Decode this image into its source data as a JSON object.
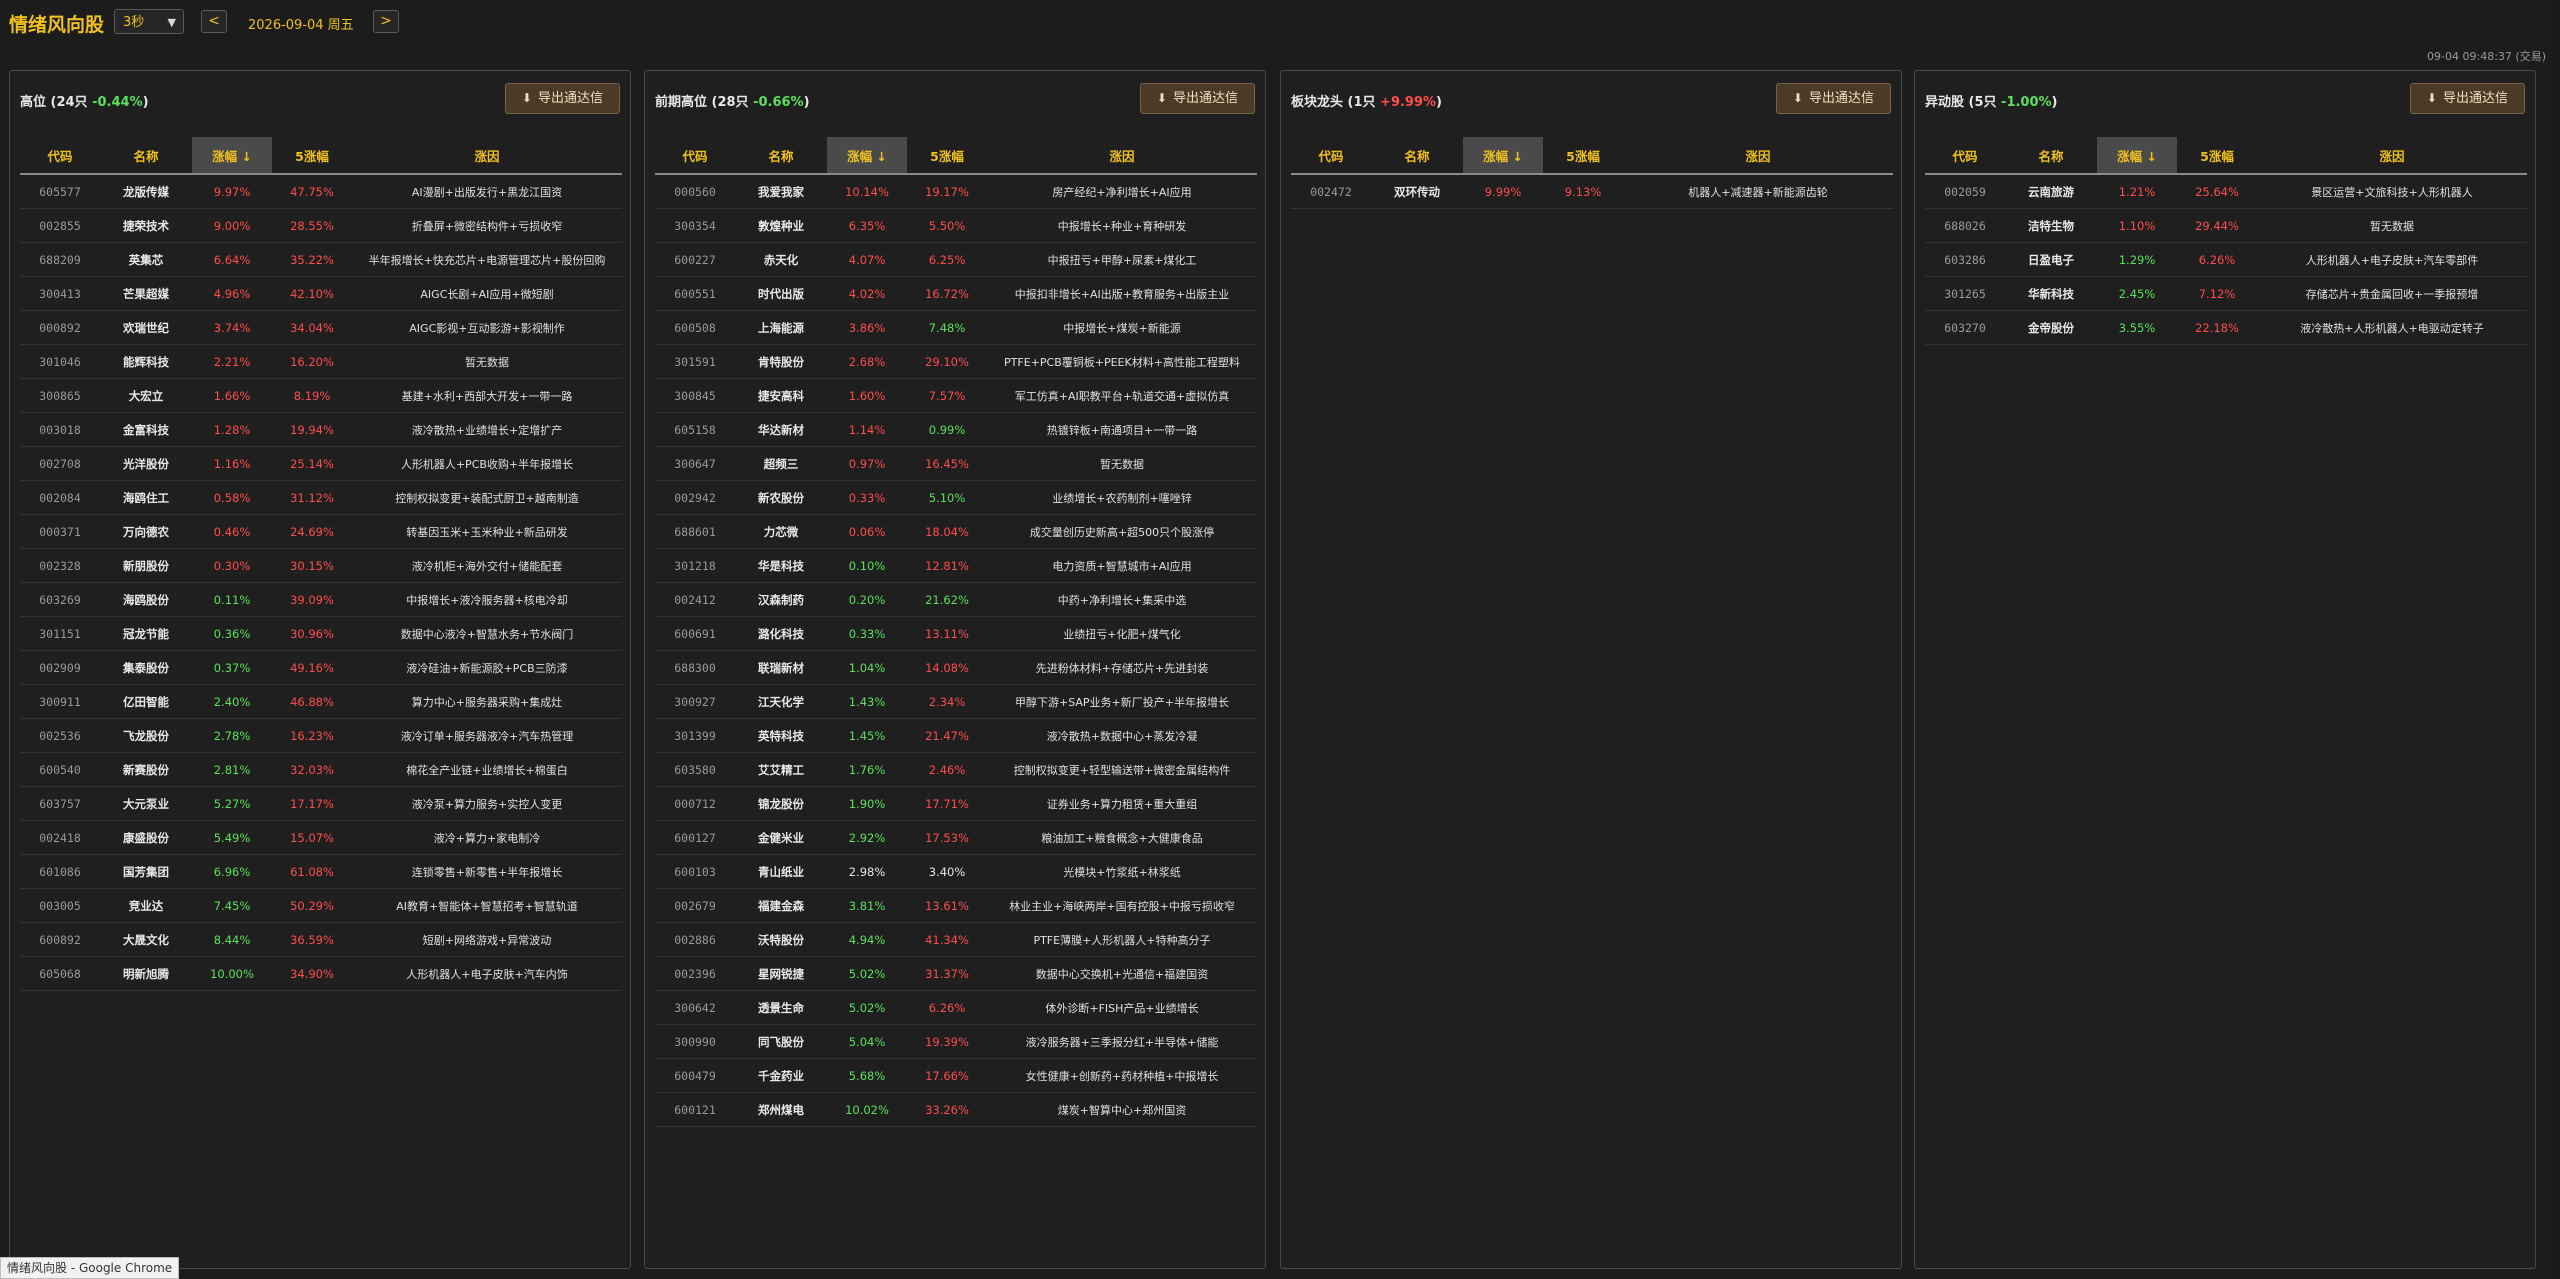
{
  "app": {
    "title": "情绪风向股",
    "interval": "3秒",
    "prev": "<",
    "next": ">",
    "date": "2026-09-04 周五",
    "timestamp": "09-04 09:48:37 (交易)",
    "status": "情绪风向股 - Google Chrome"
  },
  "columns": [
    "代码",
    "名称",
    "涨幅 ↓",
    "5涨幅",
    "涨因"
  ],
  "export_label": "导出通达信",
  "panels": [
    {
      "title": "高位 (24只 ",
      "pct": "-0.44%",
      "pct_dir": "down",
      "tail": ")",
      "rows": [
        {
          "code": "605577",
          "name": "龙版传媒",
          "chg": "9.97%",
          "chg_dir": "up",
          "chg5": "47.75%",
          "chg5_dir": "up",
          "reason": "AI漫剧+出版发行+黑龙江国资"
        },
        {
          "code": "002855",
          "name": "捷荣技术",
          "chg": "9.00%",
          "chg_dir": "up",
          "chg5": "28.55%",
          "chg5_dir": "up",
          "reason": "折叠屏+微密结构件+亏损收窄"
        },
        {
          "code": "688209",
          "name": "英集芯",
          "chg": "6.64%",
          "chg_dir": "up",
          "chg5": "35.22%",
          "chg5_dir": "up",
          "reason": "半年报增长+快充芯片+电源管理芯片+股份回购"
        },
        {
          "code": "300413",
          "name": "芒果超媒",
          "chg": "4.96%",
          "chg_dir": "up",
          "chg5": "42.10%",
          "chg5_dir": "up",
          "reason": "AIGC长剧+AI应用+微短剧"
        },
        {
          "code": "000892",
          "name": "欢瑞世纪",
          "chg": "3.74%",
          "chg_dir": "up",
          "chg5": "34.04%",
          "chg5_dir": "up",
          "reason": "AIGC影视+互动影游+影视制作"
        },
        {
          "code": "301046",
          "name": "能辉科技",
          "chg": "2.21%",
          "chg_dir": "up",
          "chg5": "16.20%",
          "chg5_dir": "up",
          "reason": "暂无数据"
        },
        {
          "code": "300865",
          "name": "大宏立",
          "chg": "1.66%",
          "chg_dir": "up",
          "chg5": "8.19%",
          "chg5_dir": "up",
          "reason": "基建+水利+西部大开发+一带一路"
        },
        {
          "code": "003018",
          "name": "金富科技",
          "chg": "1.28%",
          "chg_dir": "up",
          "chg5": "19.94%",
          "chg5_dir": "up",
          "reason": "液冷散热+业绩增长+定增扩产"
        },
        {
          "code": "002708",
          "name": "光洋股份",
          "chg": "1.16%",
          "chg_dir": "up",
          "chg5": "25.14%",
          "chg5_dir": "up",
          "reason": "人形机器人+PCB收购+半年报增长"
        },
        {
          "code": "002084",
          "name": "海鸥住工",
          "chg": "0.58%",
          "chg_dir": "up",
          "chg5": "31.12%",
          "chg5_dir": "up",
          "reason": "控制权拟变更+装配式厨卫+越南制造"
        },
        {
          "code": "000371",
          "name": "万向德农",
          "chg": "0.46%",
          "chg_dir": "up",
          "chg5": "24.69%",
          "chg5_dir": "up",
          "reason": "转基因玉米+玉米种业+新品研发"
        },
        {
          "code": "002328",
          "name": "新朋股份",
          "chg": "0.30%",
          "chg_dir": "up",
          "chg5": "30.15%",
          "chg5_dir": "up",
          "reason": "液冷机柜+海外交付+储能配套"
        },
        {
          "code": "603269",
          "name": "海鸥股份",
          "chg": "0.11%",
          "chg_dir": "down",
          "chg5": "39.09%",
          "chg5_dir": "up",
          "reason": "中报增长+液冷服务器+核电冷却"
        },
        {
          "code": "301151",
          "name": "冠龙节能",
          "chg": "0.36%",
          "chg_dir": "down",
          "chg5": "30.96%",
          "chg5_dir": "up",
          "reason": "数据中心液冷+智慧水务+节水阀门"
        },
        {
          "code": "002909",
          "name": "集泰股份",
          "chg": "0.37%",
          "chg_dir": "down",
          "chg5": "49.16%",
          "chg5_dir": "up",
          "reason": "液冷硅油+新能源胶+PCB三防漆"
        },
        {
          "code": "300911",
          "name": "亿田智能",
          "chg": "2.40%",
          "chg_dir": "down",
          "chg5": "46.88%",
          "chg5_dir": "up",
          "reason": "算力中心+服务器采购+集成灶"
        },
        {
          "code": "002536",
          "name": "飞龙股份",
          "chg": "2.78%",
          "chg_dir": "down",
          "chg5": "16.23%",
          "chg5_dir": "up",
          "reason": "液冷订单+服务器液冷+汽车热管理"
        },
        {
          "code": "600540",
          "name": "新赛股份",
          "chg": "2.81%",
          "chg_dir": "down",
          "chg5": "32.03%",
          "chg5_dir": "up",
          "reason": "棉花全产业链+业绩增长+棉蛋白"
        },
        {
          "code": "603757",
          "name": "大元泵业",
          "chg": "5.27%",
          "chg_dir": "down",
          "chg5": "17.17%",
          "chg5_dir": "up",
          "reason": "液冷泵+算力服务+实控人变更"
        },
        {
          "code": "002418",
          "name": "康盛股份",
          "chg": "5.49%",
          "chg_dir": "down",
          "chg5": "15.07%",
          "chg5_dir": "up",
          "reason": "液冷+算力+家电制冷"
        },
        {
          "code": "601086",
          "name": "国芳集团",
          "chg": "6.96%",
          "chg_dir": "down",
          "chg5": "61.08%",
          "chg5_dir": "up",
          "reason": "连锁零售+新零售+半年报增长"
        },
        {
          "code": "003005",
          "name": "竞业达",
          "chg": "7.45%",
          "chg_dir": "down",
          "chg5": "50.29%",
          "chg5_dir": "up",
          "reason": "AI教育+智能体+智慧招考+智慧轨道"
        },
        {
          "code": "600892",
          "name": "大晟文化",
          "chg": "8.44%",
          "chg_dir": "down",
          "chg5": "36.59%",
          "chg5_dir": "up",
          "reason": "短剧+网络游戏+异常波动"
        },
        {
          "code": "605068",
          "name": "明新旭腾",
          "chg": "10.00%",
          "chg_dir": "down",
          "chg5": "34.90%",
          "chg5_dir": "up",
          "reason": "人形机器人+电子皮肤+汽车内饰"
        }
      ]
    },
    {
      "title": "前期高位 (28只 ",
      "pct": "-0.66%",
      "pct_dir": "down",
      "tail": ")",
      "rows": [
        {
          "code": "000560",
          "name": "我爱我家",
          "chg": "10.14%",
          "chg_dir": "up",
          "chg5": "19.17%",
          "chg5_dir": "up",
          "reason": "房产经纪+净利增长+AI应用"
        },
        {
          "code": "300354",
          "name": "敦煌种业",
          "chg": "6.35%",
          "chg_dir": "up",
          "chg5": "5.50%",
          "chg5_dir": "up",
          "reason": "中报增长+种业+育种研发"
        },
        {
          "code": "600227",
          "name": "赤天化",
          "chg": "4.07%",
          "chg_dir": "up",
          "chg5": "6.25%",
          "chg5_dir": "up",
          "reason": "中报扭亏+甲醇+尿素+煤化工"
        },
        {
          "code": "600551",
          "name": "时代出版",
          "chg": "4.02%",
          "chg_dir": "up",
          "chg5": "16.72%",
          "chg5_dir": "up",
          "reason": "中报扣非增长+AI出版+教育服务+出版主业"
        },
        {
          "code": "600508",
          "name": "上海能源",
          "chg": "3.86%",
          "chg_dir": "up",
          "chg5": "7.48%",
          "chg5_dir": "down",
          "reason": "中报增长+煤炭+新能源"
        },
        {
          "code": "301591",
          "name": "肯特股份",
          "chg": "2.68%",
          "chg_dir": "up",
          "chg5": "29.10%",
          "chg5_dir": "up",
          "reason": "PTFE+PCB覆铜板+PEEK材料+高性能工程塑料"
        },
        {
          "code": "300845",
          "name": "捷安高科",
          "chg": "1.60%",
          "chg_dir": "up",
          "chg5": "7.57%",
          "chg5_dir": "up",
          "reason": "军工仿真+AI职教平台+轨道交通+虚拟仿真"
        },
        {
          "code": "605158",
          "name": "华达新材",
          "chg": "1.14%",
          "chg_dir": "up",
          "chg5": "0.99%",
          "chg5_dir": "down",
          "reason": "热镀锌板+南通项目+一带一路"
        },
        {
          "code": "300647",
          "name": "超频三",
          "chg": "0.97%",
          "chg_dir": "up",
          "chg5": "16.45%",
          "chg5_dir": "up",
          "reason": "暂无数据"
        },
        {
          "code": "002942",
          "name": "新农股份",
          "chg": "0.33%",
          "chg_dir": "up",
          "chg5": "5.10%",
          "chg5_dir": "down",
          "reason": "业绩增长+农药制剂+噻唑锌"
        },
        {
          "code": "688601",
          "name": "力芯微",
          "chg": "0.06%",
          "chg_dir": "up",
          "chg5": "18.04%",
          "chg5_dir": "up",
          "reason": "成交量创历史新高+超500只个股涨停"
        },
        {
          "code": "301218",
          "name": "华是科技",
          "chg": "0.10%",
          "chg_dir": "down",
          "chg5": "12.81%",
          "chg5_dir": "up",
          "reason": "电力资质+智慧城市+AI应用"
        },
        {
          "code": "002412",
          "name": "汉森制药",
          "chg": "0.20%",
          "chg_dir": "down",
          "chg5": "21.62%",
          "chg5_dir": "down",
          "reason": "中药+净利增长+集采中选"
        },
        {
          "code": "600691",
          "name": "潞化科技",
          "chg": "0.33%",
          "chg_dir": "down",
          "chg5": "13.11%",
          "chg5_dir": "up",
          "reason": "业绩扭亏+化肥+煤气化"
        },
        {
          "code": "688300",
          "name": "联瑞新材",
          "chg": "1.04%",
          "chg_dir": "down",
          "chg5": "14.08%",
          "chg5_dir": "up",
          "reason": "先进粉体材料+存储芯片+先进封装"
        },
        {
          "code": "300927",
          "name": "江天化学",
          "chg": "1.43%",
          "chg_dir": "down",
          "chg5": "2.34%",
          "chg5_dir": "up",
          "reason": "甲醇下游+SAP业务+新厂投产+半年报增长"
        },
        {
          "code": "301399",
          "name": "英特科技",
          "chg": "1.45%",
          "chg_dir": "down",
          "chg5": "21.47%",
          "chg5_dir": "up",
          "reason": "液冷散热+数据中心+蒸发冷凝"
        },
        {
          "code": "603580",
          "name": "艾艾精工",
          "chg": "1.76%",
          "chg_dir": "down",
          "chg5": "2.46%",
          "chg5_dir": "up",
          "reason": "控制权拟变更+轻型输送带+微密金属结构件"
        },
        {
          "code": "000712",
          "name": "锦龙股份",
          "chg": "1.90%",
          "chg_dir": "down",
          "chg5": "17.71%",
          "chg5_dir": "up",
          "reason": "证券业务+算力租赁+重大重组"
        },
        {
          "code": "600127",
          "name": "金健米业",
          "chg": "2.92%",
          "chg_dir": "down",
          "chg5": "17.53%",
          "chg5_dir": "up",
          "reason": "粮油加工+粮食概念+大健康食品"
        },
        {
          "code": "600103",
          "name": "青山纸业",
          "chg": "2.98%",
          "chg_dir": "flat",
          "chg5": "3.40%",
          "chg5_dir": "flat",
          "reason": "光模块+竹浆纸+林浆纸"
        },
        {
          "code": "002679",
          "name": "福建金森",
          "chg": "3.81%",
          "chg_dir": "down",
          "chg5": "13.61%",
          "chg5_dir": "up",
          "reason": "林业主业+海峡两岸+国有控股+中报亏损收窄"
        },
        {
          "code": "002886",
          "name": "沃特股份",
          "chg": "4.94%",
          "chg_dir": "down",
          "chg5": "41.34%",
          "chg5_dir": "up",
          "reason": "PTFE薄膜+人形机器人+特种高分子"
        },
        {
          "code": "002396",
          "name": "星网锐捷",
          "chg": "5.02%",
          "chg_dir": "down",
          "chg5": "31.37%",
          "chg5_dir": "up",
          "reason": "数据中心交换机+光通信+福建国资"
        },
        {
          "code": "300642",
          "name": "透景生命",
          "chg": "5.02%",
          "chg_dir": "down",
          "chg5": "6.26%",
          "chg5_dir": "up",
          "reason": "体外诊断+FISH产品+业绩增长"
        },
        {
          "code": "300990",
          "name": "同飞股份",
          "chg": "5.04%",
          "chg_dir": "down",
          "chg5": "19.39%",
          "chg5_dir": "up",
          "reason": "液冷服务器+三季报分红+半导体+储能"
        },
        {
          "code": "600479",
          "name": "千金药业",
          "chg": "5.68%",
          "chg_dir": "down",
          "chg5": "17.66%",
          "chg5_dir": "up",
          "reason": "女性健康+创新药+药材种植+中报增长"
        },
        {
          "code": "600121",
          "name": "郑州煤电",
          "chg": "10.02%",
          "chg_dir": "down",
          "chg5": "33.26%",
          "chg5_dir": "up",
          "reason": "煤炭+智算中心+郑州国资"
        }
      ]
    },
    {
      "title": "板块龙头 (1只 ",
      "pct": "+9.99%",
      "pct_dir": "up",
      "tail": ")",
      "rows": [
        {
          "code": "002472",
          "name": "双环传动",
          "chg": "9.99%",
          "chg_dir": "up",
          "chg5": "9.13%",
          "chg5_dir": "up",
          "reason": "机器人+减速器+新能源齿轮"
        }
      ]
    },
    {
      "title": "异动股 (5只 ",
      "pct": "-1.00%",
      "pct_dir": "down",
      "tail": ")",
      "rows": [
        {
          "code": "002059",
          "name": "云南旅游",
          "chg": "1.21%",
          "chg_dir": "up",
          "chg5": "25.64%",
          "chg5_dir": "up",
          "reason": "景区运营+文旅科技+人形机器人"
        },
        {
          "code": "688026",
          "name": "洁特生物",
          "chg": "1.10%",
          "chg_dir": "up",
          "chg5": "29.44%",
          "chg5_dir": "up",
          "reason": "暂无数据"
        },
        {
          "code": "603286",
          "name": "日盈电子",
          "chg": "1.29%",
          "chg_dir": "down",
          "chg5": "6.26%",
          "chg5_dir": "up",
          "reason": "人形机器人+电子皮肤+汽车零部件"
        },
        {
          "code": "301265",
          "name": "华新科技",
          "chg": "2.45%",
          "chg_dir": "down",
          "chg5": "7.12%",
          "chg5_dir": "up",
          "reason": "存储芯片+贵金属回收+一季报预增"
        },
        {
          "code": "603270",
          "name": "金帝股份",
          "chg": "3.55%",
          "chg_dir": "down",
          "chg5": "22.18%",
          "chg5_dir": "up",
          "reason": "液冷散热+人形机器人+电驱动定转子"
        }
      ]
    }
  ]
}
